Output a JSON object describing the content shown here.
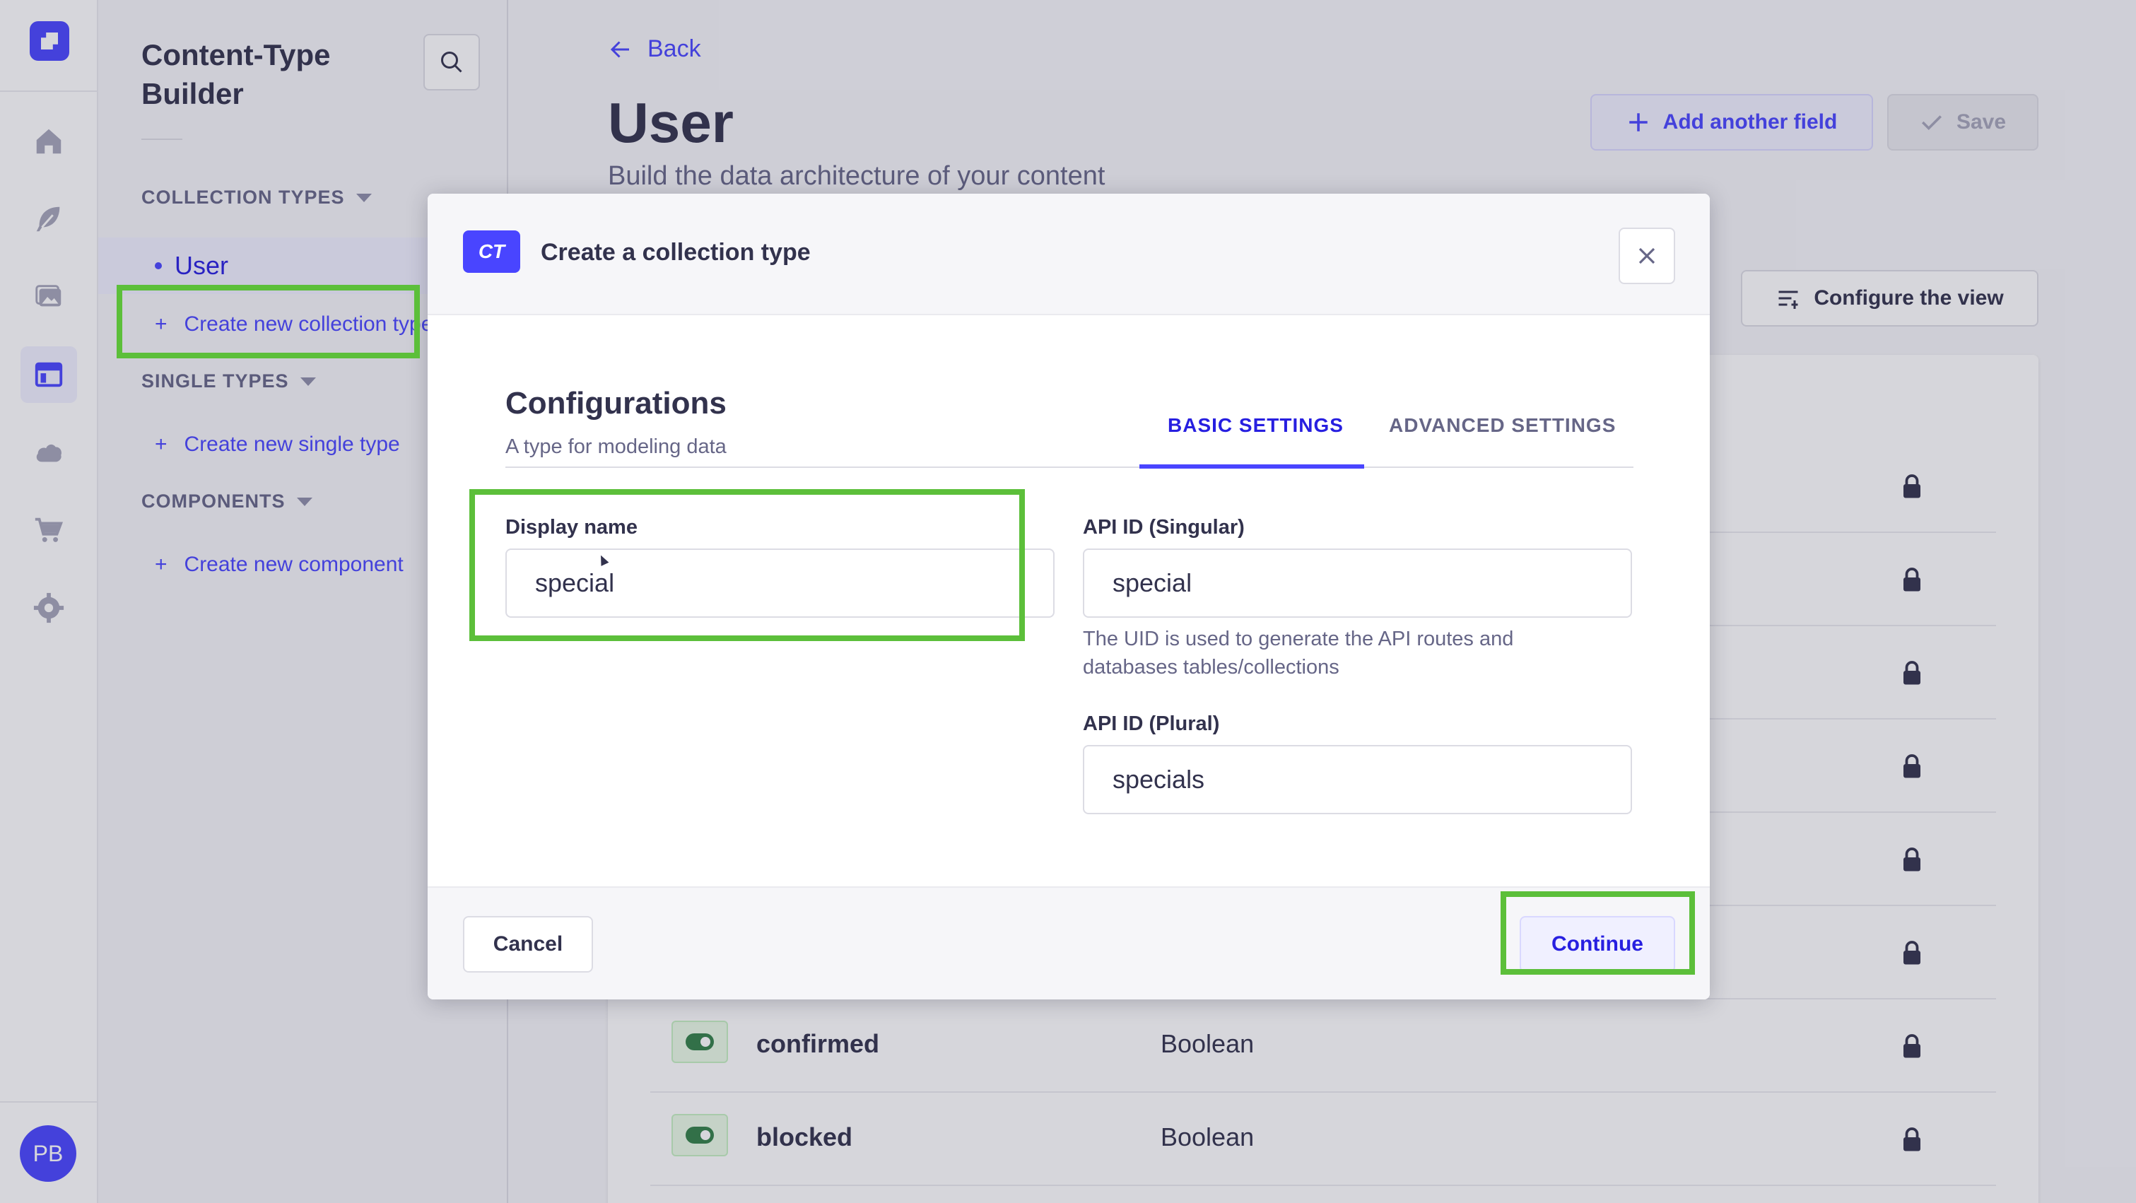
{
  "sidebar": {
    "title": "Content-Type Builder",
    "collection_types_label": "COLLECTION TYPES",
    "collection_items": [
      "User"
    ],
    "create_collection": "Create new collection type",
    "single_types_label": "SINGLE TYPES",
    "create_single": "Create new single type",
    "components_label": "COMPONENTS",
    "create_component": "Create new component",
    "user_initials": "PB"
  },
  "header": {
    "back": "Back",
    "title": "User",
    "subtitle": "Build the data architecture of your content",
    "add_field": "Add another field",
    "save": "Save",
    "configure_view": "Configure the view"
  },
  "fields": [
    {
      "name": "confirmed",
      "type": "Boolean",
      "icon": "toggle-icon"
    },
    {
      "name": "blocked",
      "type": "Boolean",
      "icon": "toggle-icon"
    }
  ],
  "modal": {
    "badge": "CT",
    "title": "Create a collection type",
    "section_title": "Configurations",
    "section_subtitle": "A type for modeling data",
    "tab_basic": "BASIC SETTINGS",
    "tab_advanced": "ADVANCED SETTINGS",
    "display_name_label": "Display name",
    "display_name_value": "special",
    "api_singular_label": "API ID (Singular)",
    "api_singular_value": "special",
    "api_hint": "The UID is used to generate the API routes and databases tables/collections",
    "api_plural_label": "API ID (Plural)",
    "api_plural_value": "specials",
    "cancel": "Cancel",
    "continue": "Continue"
  },
  "colors": {
    "primary": "#4945ff",
    "highlight": "#5cbf3a",
    "text": "#32324d"
  }
}
